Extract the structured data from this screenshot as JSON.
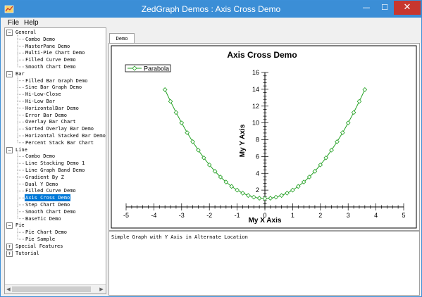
{
  "window": {
    "title": "ZedGraph Demos : Axis Cross Demo"
  },
  "menu": {
    "file": "File",
    "help": "Help"
  },
  "tree": [
    {
      "label": "General",
      "level": 0,
      "expander": "−"
    },
    {
      "label": "Combo Demo",
      "level": 1
    },
    {
      "label": "MasterPane Demo",
      "level": 1
    },
    {
      "label": "Multi-Pie Chart Demo",
      "level": 1
    },
    {
      "label": "Filled Curve Demo",
      "level": 1
    },
    {
      "label": "Smooth Chart Demo",
      "level": 1
    },
    {
      "label": "Bar",
      "level": 0,
      "expander": "−"
    },
    {
      "label": "Filled Bar Graph Demo",
      "level": 1
    },
    {
      "label": "Sine Bar Graph Demo",
      "level": 1
    },
    {
      "label": "Hi-Low-Close",
      "level": 1
    },
    {
      "label": "Hi-Low Bar",
      "level": 1
    },
    {
      "label": "HorizontalBar Demo",
      "level": 1
    },
    {
      "label": "Error Bar Demo",
      "level": 1
    },
    {
      "label": "Overlay Bar Chart",
      "level": 1
    },
    {
      "label": "Sorted Overlay Bar Demo",
      "level": 1
    },
    {
      "label": "Horizontal Stacked Bar Demo",
      "level": 1
    },
    {
      "label": "Percent Stack Bar Chart",
      "level": 1
    },
    {
      "label": "Line",
      "level": 0,
      "expander": "−"
    },
    {
      "label": "Combo Demo",
      "level": 1
    },
    {
      "label": "Line Stacking Demo 1",
      "level": 1
    },
    {
      "label": "Line Graph Band Demo",
      "level": 1
    },
    {
      "label": "Gradient By Z",
      "level": 1
    },
    {
      "label": "Dual Y Demo",
      "level": 1
    },
    {
      "label": "Filled Curve Demo",
      "level": 1
    },
    {
      "label": "Axis Cross Demo",
      "level": 1,
      "selected": true
    },
    {
      "label": "Step Chart Demo",
      "level": 1
    },
    {
      "label": "Smooth Chart Demo",
      "level": 1
    },
    {
      "label": "BaseTic Demo",
      "level": 1
    },
    {
      "label": "Pie",
      "level": 0,
      "expander": "−"
    },
    {
      "label": "Pie Chart Demo",
      "level": 1
    },
    {
      "label": "Pie Sample",
      "level": 1
    },
    {
      "label": "Special Features",
      "level": 0,
      "expander": "+"
    },
    {
      "label": "Tutorial",
      "level": 0,
      "expander": "+"
    }
  ],
  "tab": {
    "label": "Demo"
  },
  "description": "Simple Graph with Y Axis in Alternate Location",
  "colors": {
    "titlebar": "#3b8ed6",
    "selection": "#0078d7",
    "curve": "#22a022"
  },
  "chart_data": {
    "type": "line",
    "title": "Axis Cross Demo",
    "xlabel": "My X Axis",
    "ylabel": "My Y Axis",
    "xlim": [
      -5,
      5
    ],
    "ylim": [
      0,
      16
    ],
    "xticks": [
      "-5",
      "-4",
      "-3",
      "-2",
      "-1",
      "0",
      "1",
      "2",
      "3",
      "4",
      "5"
    ],
    "yticks": [
      "2",
      "4",
      "6",
      "8",
      "10",
      "12",
      "14",
      "16"
    ],
    "legend_position": "top-left",
    "series": [
      {
        "name": "Parabola",
        "marker": "diamond",
        "x": [
          -3.6,
          -3.4,
          -3.2,
          -3.0,
          -2.8,
          -2.6,
          -2.4,
          -2.2,
          -2.0,
          -1.8,
          -1.6,
          -1.4,
          -1.2,
          -1.0,
          -0.8,
          -0.6,
          -0.4,
          -0.2,
          0.0,
          0.2,
          0.4,
          0.6,
          0.8,
          1.0,
          1.2,
          1.4,
          1.6,
          1.8,
          2.0,
          2.2,
          2.4,
          2.6,
          2.8,
          3.0,
          3.2,
          3.4,
          3.6
        ],
        "y": [
          13.96,
          12.56,
          11.24,
          10.0,
          8.84,
          7.76,
          6.76,
          5.84,
          5.0,
          4.24,
          3.56,
          2.96,
          2.44,
          2.0,
          1.64,
          1.36,
          1.16,
          1.04,
          1.0,
          1.04,
          1.16,
          1.36,
          1.64,
          2.0,
          2.44,
          2.96,
          3.56,
          4.24,
          5.0,
          5.84,
          6.76,
          7.76,
          8.84,
          10.0,
          11.24,
          12.56,
          13.96
        ]
      }
    ]
  }
}
